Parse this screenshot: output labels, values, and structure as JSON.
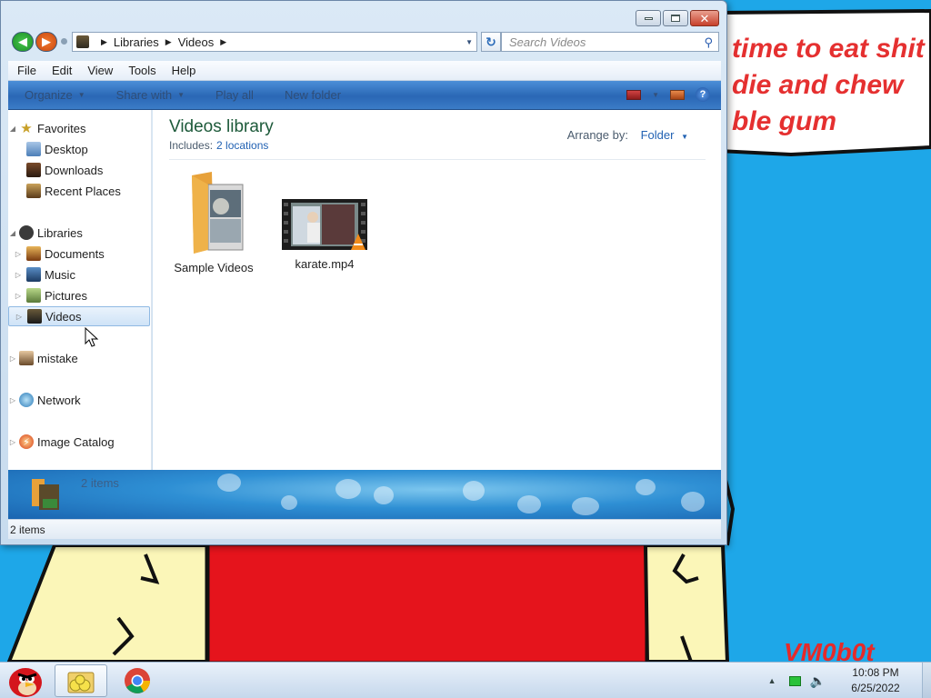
{
  "wallpaper": {
    "bubble_text": "time to eat shit\ndie and chew\nble gum",
    "signature": "VM0b0t"
  },
  "window": {
    "nav": {
      "breadcrumbs": [
        "Libraries",
        "Videos"
      ],
      "search_placeholder": "Search Videos"
    },
    "menu": [
      "File",
      "Edit",
      "View",
      "Tools",
      "Help"
    ],
    "commands": {
      "organize": "Organize",
      "share_with": "Share with",
      "play_all": "Play all",
      "new_folder": "New folder"
    },
    "nav_pane": {
      "favorites": {
        "label": "Favorites",
        "items": [
          "Desktop",
          "Downloads",
          "Recent Places"
        ]
      },
      "libraries": {
        "label": "Libraries",
        "items": [
          "Documents",
          "Music",
          "Pictures",
          "Videos"
        ],
        "selected": "Videos"
      },
      "mistake": "mistake",
      "network": "Network",
      "image_catalog": "Image Catalog"
    },
    "content": {
      "title": "Videos library",
      "includes_label": "Includes:",
      "locations_link": "2 locations",
      "arrange_label": "Arrange by:",
      "arrange_value": "Folder",
      "files": [
        {
          "name": "Sample Videos",
          "type": "folder"
        },
        {
          "name": "karate.mp4",
          "type": "video"
        }
      ]
    },
    "details": {
      "text": "2 items"
    },
    "status": {
      "text": "2 items"
    }
  },
  "taskbar": {
    "time": "10:08 PM",
    "date": "6/25/2022"
  },
  "colors": {
    "desktop": "#1ea7e8",
    "command_bar": "#2a67b5",
    "wallpaper_red": "#e52a2a",
    "title_green": "#1d5a3a",
    "link_blue": "#2262b3"
  }
}
